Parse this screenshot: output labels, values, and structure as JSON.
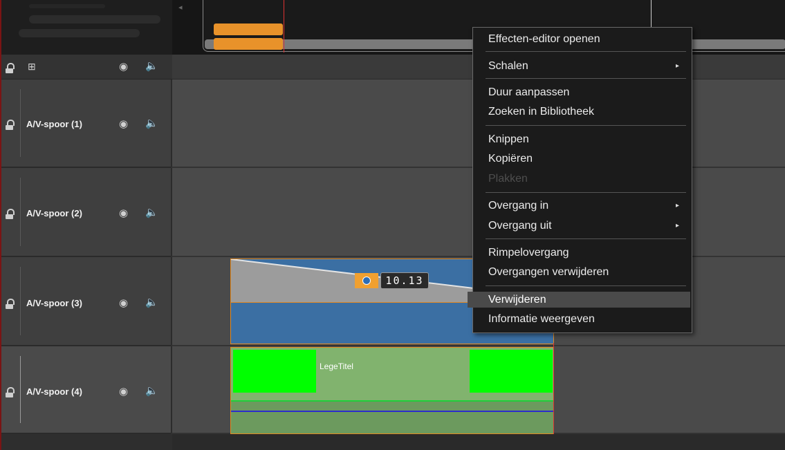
{
  "tracks": [
    {
      "name": "A/V-spoor (1)"
    },
    {
      "name": "A/V-spoor (2)"
    },
    {
      "name": "A/V-spoor (3)"
    },
    {
      "name": "A/V-spoor (4)"
    }
  ],
  "clip_track3": {
    "keyframe_value": "10.13"
  },
  "clip_track4": {
    "title": "LegeTitel"
  },
  "context_menu": {
    "items": [
      {
        "label": "Effecten-editor openen"
      },
      {
        "label": "Schalen",
        "submenu": true
      },
      {
        "label": "Duur aanpassen"
      },
      {
        "label": "Zoeken in Bibliotheek"
      },
      {
        "label": "Knippen"
      },
      {
        "label": "Kopiëren"
      },
      {
        "label": "Plakken",
        "disabled": true
      },
      {
        "label": "Overgang in",
        "submenu": true
      },
      {
        "label": "Overgang uit",
        "submenu": true
      },
      {
        "label": "Rimpelovergang"
      },
      {
        "label": "Overgangen verwijderen"
      },
      {
        "label": "Verwijderen",
        "highlighted": true
      },
      {
        "label": "Informatie weergeven"
      }
    ],
    "submenu_arrow": "▸"
  },
  "colors": {
    "clip_border": "#e38a22",
    "playhead": "#e03232",
    "title_green": "#00ff00",
    "audio_blue": "#3b6fa3"
  }
}
